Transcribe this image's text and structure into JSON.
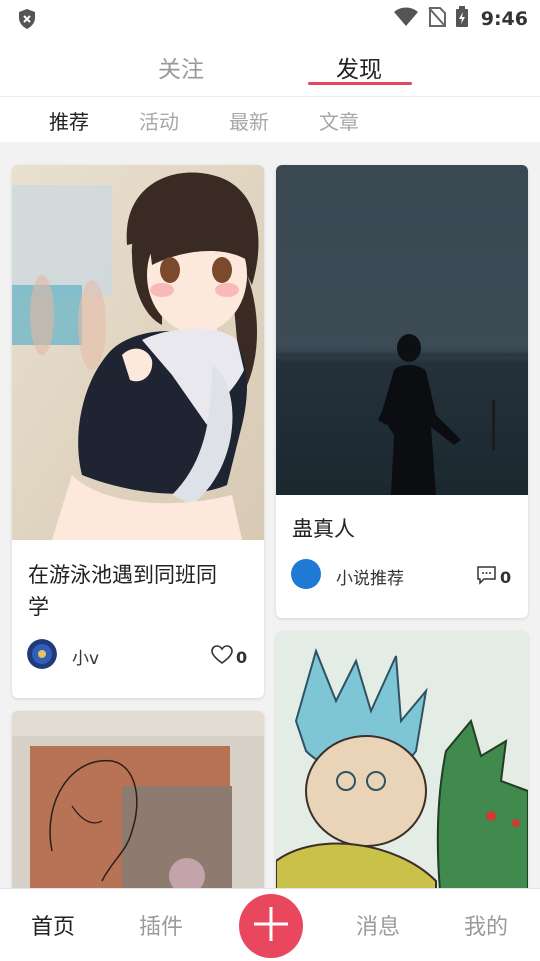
{
  "status_bar": {
    "time": "9:46",
    "icons": [
      "shield-icon",
      "wifi-icon",
      "no-sim-icon",
      "battery-charging-icon"
    ]
  },
  "top_tabs": [
    {
      "label": "关注",
      "active": false
    },
    {
      "label": "发现",
      "active": true
    }
  ],
  "sub_tabs": [
    {
      "label": "推荐",
      "active": true
    },
    {
      "label": "活动",
      "active": false
    },
    {
      "label": "最新",
      "active": false
    },
    {
      "label": "文章",
      "active": false
    }
  ],
  "cards": [
    {
      "title_line1": "在游泳池遇到同班同",
      "title_line2": "学",
      "author": "小v",
      "count": "0",
      "count_icon": "heart-icon"
    },
    {
      "title": "蛊真人",
      "author": "小说推荐",
      "count": "0",
      "count_icon": "comment-icon"
    },
    {
      "title": "",
      "author": "",
      "count": ""
    },
    {
      "title": "",
      "author": "",
      "count": ""
    }
  ],
  "bottom_nav": [
    {
      "label": "首页",
      "active": true
    },
    {
      "label": "插件",
      "active": false
    },
    {
      "label": "",
      "icon": "plus-icon"
    },
    {
      "label": "消息",
      "active": false
    },
    {
      "label": "我的",
      "active": false
    }
  ],
  "colors": {
    "accent": "#e8475e",
    "avatar_blue": "#1f7ad6"
  }
}
